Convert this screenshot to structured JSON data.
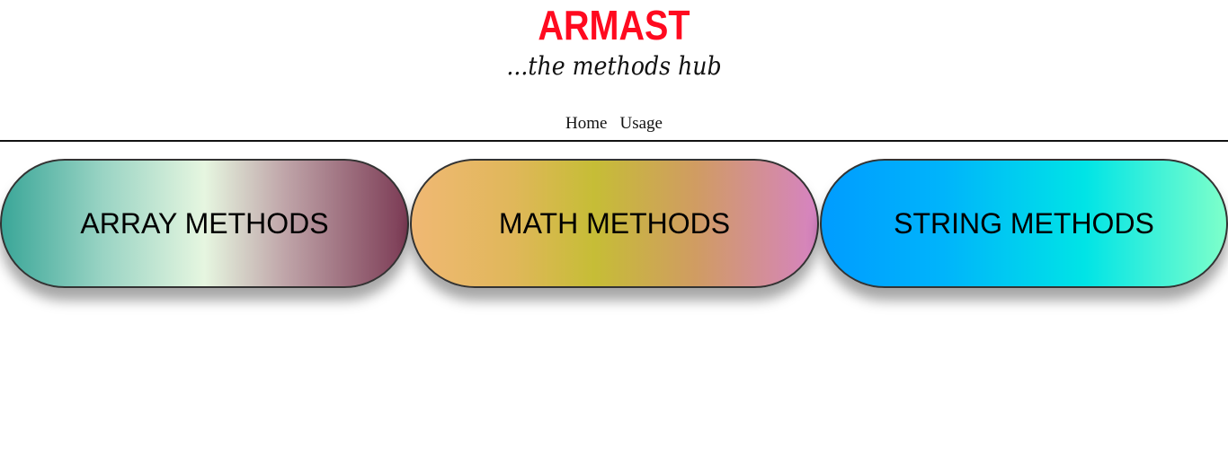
{
  "brand": {
    "title": "ARMAST",
    "tagline": "...the methods hub",
    "title_color": "#ff0a1f"
  },
  "nav": {
    "items": [
      {
        "label": "Home"
      },
      {
        "label": "Usage"
      }
    ]
  },
  "cards": [
    {
      "label": "ARRAY METHODS",
      "gradient": [
        "#3aa698",
        "#e6f6e0",
        "#7c3b55"
      ]
    },
    {
      "label": "MATH METHODS",
      "gradient": [
        "#f0b874",
        "#c6bd36",
        "#d683c2"
      ]
    },
    {
      "label": "STRING METHODS",
      "gradient": [
        "#009cff",
        "#00e4e6",
        "#7effca"
      ]
    }
  ]
}
